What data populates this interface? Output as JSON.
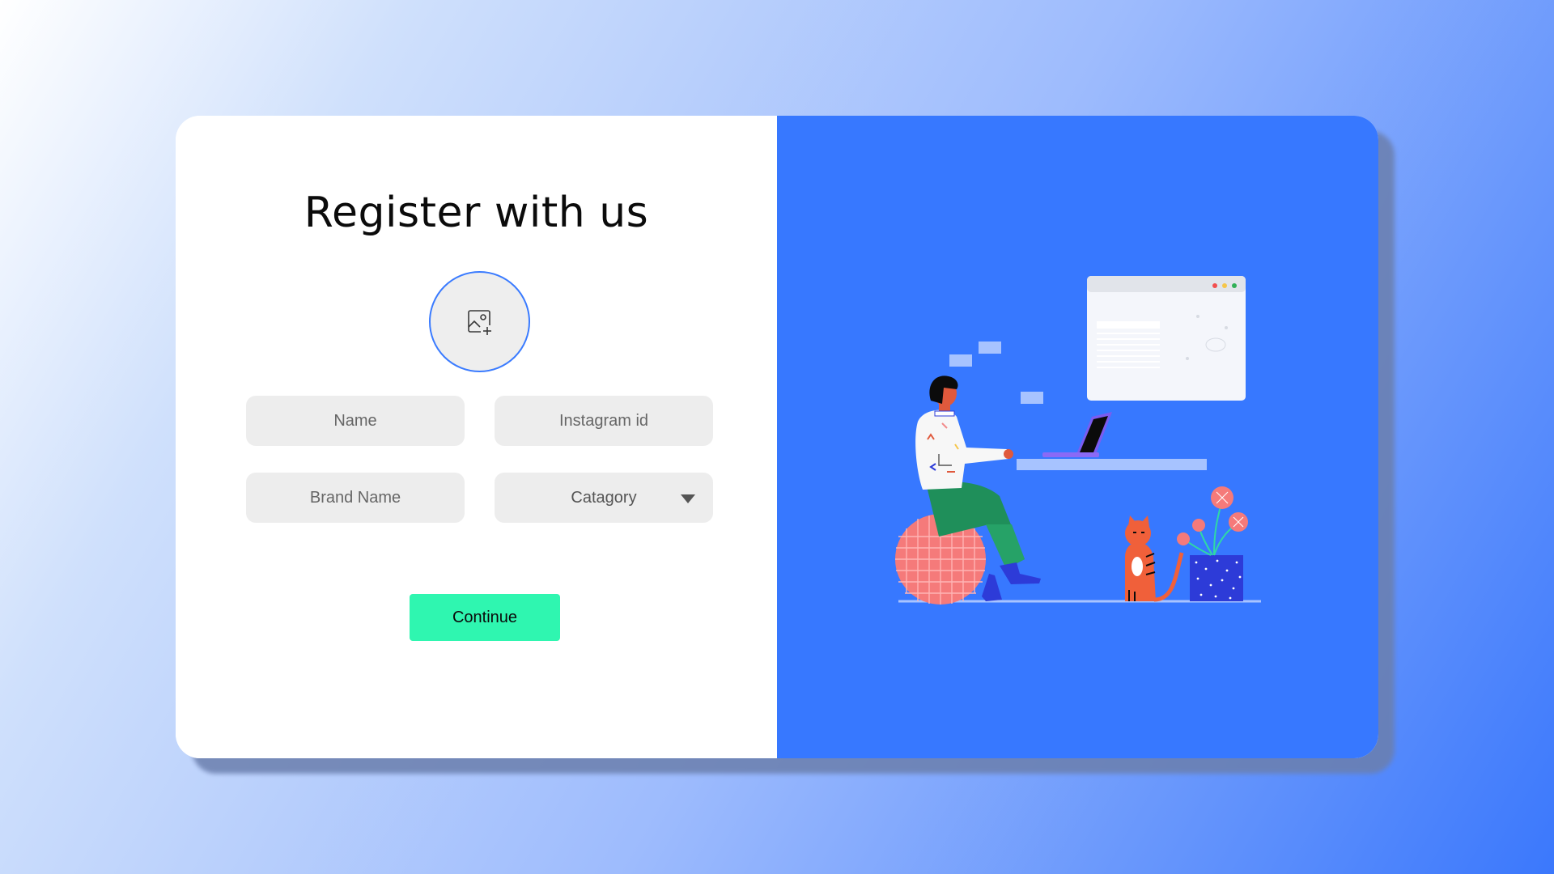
{
  "form": {
    "title": "Register with us",
    "name_placeholder": "Name",
    "instagram_placeholder": "Instagram id",
    "brand_placeholder": "Brand Name",
    "category_label": "Catagory",
    "continue_label": "Continue"
  },
  "icons": {
    "upload": "image-add-icon",
    "dropdown": "triangle-down-icon"
  },
  "colors": {
    "accent_blue": "#3778ff",
    "button_green": "#2ff6b0",
    "field_bg": "#ededed",
    "avatar_border": "#3a7bff"
  }
}
